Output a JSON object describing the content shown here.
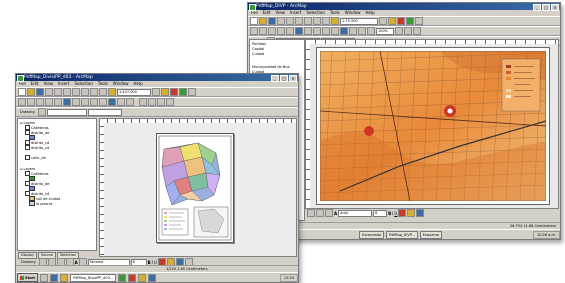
{
  "front_window": {
    "title": "PdfMap_DivisiPP_d03 - ArcMap",
    "menu": [
      "File",
      "Edit",
      "View",
      "Insert",
      "Selection",
      "Tools",
      "Window",
      "Help"
    ],
    "scale": "1:447,000",
    "toc": {
      "groups": [
        {
          "name": "Layers",
          "items": [
            "Calleteras",
            "distrito_de",
            "distrito_cd",
            "distrito_cd",
            "color_de"
          ]
        },
        {
          "name": "Layers",
          "items": [
            "Calleteras",
            "distrito_de",
            "distrito_cd",
            "call de ciudad",
            "la pizarra"
          ]
        }
      ],
      "tabs": [
        "Display",
        "Source",
        "Selection"
      ]
    },
    "drawing_label": "Drawing",
    "font": "Tahoma",
    "font_size": "8",
    "status": "1/220  2.65 Centimeters",
    "taskbar": {
      "start": "Start",
      "tasks": [
        "PdfMap_DivisiPP_d03..."
      ],
      "tray": "10:24"
    }
  },
  "back_window": {
    "title": "PdfMap_DIVP - ArcMap",
    "menu": [
      "File",
      "Edit",
      "View",
      "Insert",
      "Selection",
      "Tools",
      "Window",
      "Help"
    ],
    "scale": "1:75,500",
    "zoom": "100%",
    "drawing_label": "Editing",
    "font": "Arial",
    "font_size": "8",
    "status": "26.754  11.88 Centimeters",
    "side_text": [
      "Partidos",
      "Capital",
      "Cuidad",
      "Municipalidad de Bue",
      "Cuidad"
    ],
    "taskbar": {
      "tasks": [
        "Escaneado",
        "PdfMap_DIVP...",
        "Esquema"
      ],
      "tray": "10:26 a.m."
    }
  }
}
